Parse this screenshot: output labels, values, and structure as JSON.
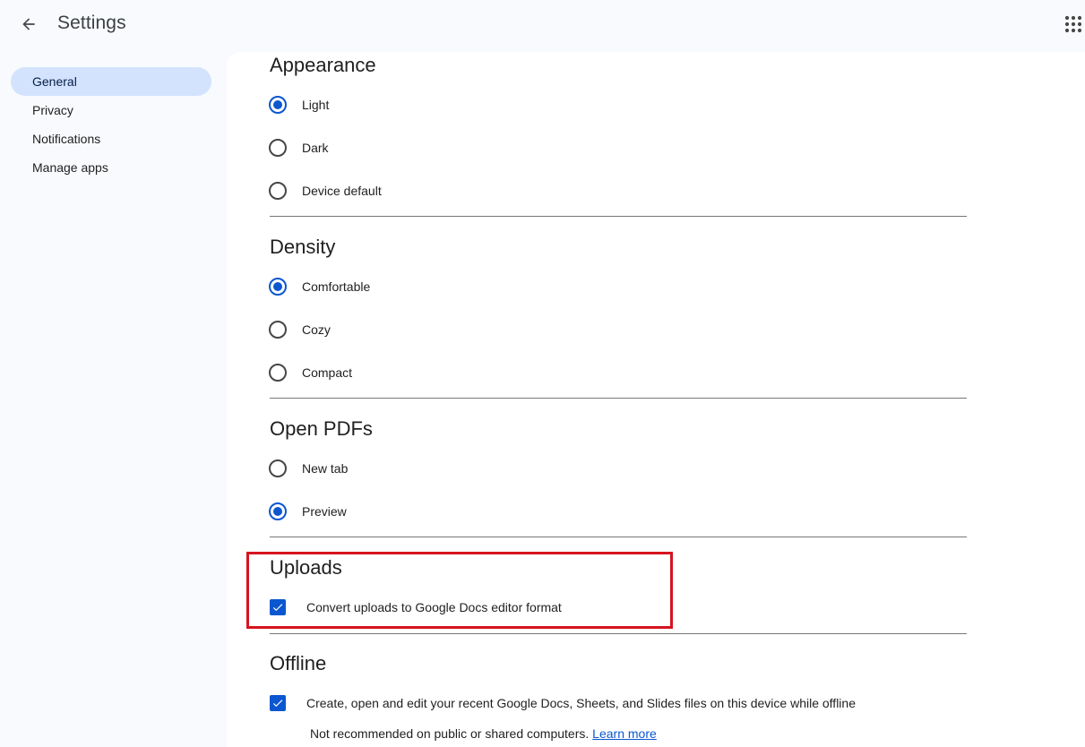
{
  "header": {
    "title": "Settings",
    "back_icon": "arrow-back-icon",
    "apps_icon": "apps-grid-icon"
  },
  "sidebar": {
    "items": [
      {
        "label": "General",
        "active": true
      },
      {
        "label": "Privacy",
        "active": false
      },
      {
        "label": "Notifications",
        "active": false
      },
      {
        "label": "Manage apps",
        "active": false
      }
    ]
  },
  "sections": {
    "appearance": {
      "title": "Appearance",
      "options": [
        {
          "label": "Light",
          "checked": true
        },
        {
          "label": "Dark",
          "checked": false
        },
        {
          "label": "Device default",
          "checked": false
        }
      ]
    },
    "density": {
      "title": "Density",
      "options": [
        {
          "label": "Comfortable",
          "checked": true
        },
        {
          "label": "Cozy",
          "checked": false
        },
        {
          "label": "Compact",
          "checked": false
        }
      ]
    },
    "open_pdfs": {
      "title": "Open PDFs",
      "options": [
        {
          "label": "New tab",
          "checked": false
        },
        {
          "label": "Preview",
          "checked": true
        }
      ]
    },
    "uploads": {
      "title": "Uploads",
      "checkbox_label": "Convert uploads to Google Docs editor format",
      "checked": true
    },
    "offline": {
      "title": "Offline",
      "checkbox_label": "Create, open and edit your recent Google Docs, Sheets, and Slides files on this device while offline",
      "checked": true,
      "note": "Not recommended on public or shared computers.",
      "link": "Learn more"
    }
  },
  "colors": {
    "accent": "#0b57d0",
    "nav_active_bg": "#d3e3fd",
    "highlight_border": "#d6141f"
  }
}
